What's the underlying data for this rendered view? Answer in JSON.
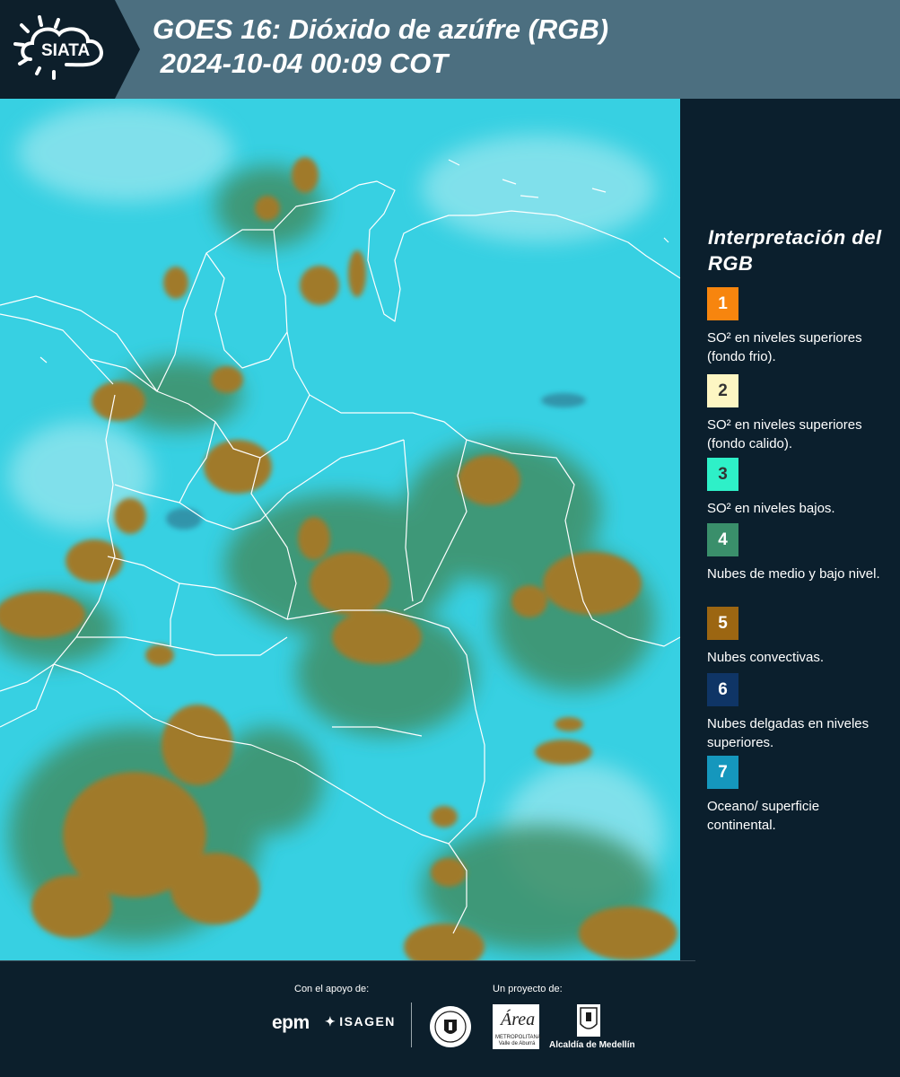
{
  "header": {
    "logo_text": "SIATA",
    "title_line1": "GOES 16: Dióxido de azúfre (RGB)",
    "title_line2": " 2024-10-04 00:09 COT",
    "bg_color": "#4c6f80",
    "logo_bg_color": "#0d1f2b"
  },
  "map": {
    "background_color": "#37d0e2",
    "convective_color": "#a07a2a",
    "mid_cloud_color": "#3f8f66",
    "border_color": "#ffffff"
  },
  "legend": {
    "title": "Interpretación del RGB",
    "items": [
      {
        "number": "1",
        "color": "#f7850e",
        "label": "SO² en niveles superiores (fondo frio)."
      },
      {
        "number": "2",
        "color": "#fdf6c3",
        "label": "SO² en niveles superiores (fondo calido)."
      },
      {
        "number": "3",
        "color": "#2ef0c8",
        "label": "SO² en niveles bajos."
      },
      {
        "number": "4",
        "color": "#3a8f6b",
        "label": "Nubes de medio y bajo nivel."
      },
      {
        "number": "5",
        "color": "#9c6612",
        "label": "Nubes convectivas."
      },
      {
        "number": "6",
        "color": "#0f3566",
        "label": "Nubes delgadas en niveles superiores."
      },
      {
        "number": "7",
        "color": "#1597bd",
        "label": "Oceano/ superficie continental."
      }
    ]
  },
  "footer": {
    "support_label": "Con el apoyo de:",
    "project_label": "Un proyecto de:",
    "epm_logo_text": "epm",
    "isagen_logo_text": "ISAGEN",
    "area_logo_text": "Área",
    "area_logo_subtext": "METROPOLITANA Valle de Aburrá",
    "alcaldia_text": "Alcaldía de Medellín"
  }
}
